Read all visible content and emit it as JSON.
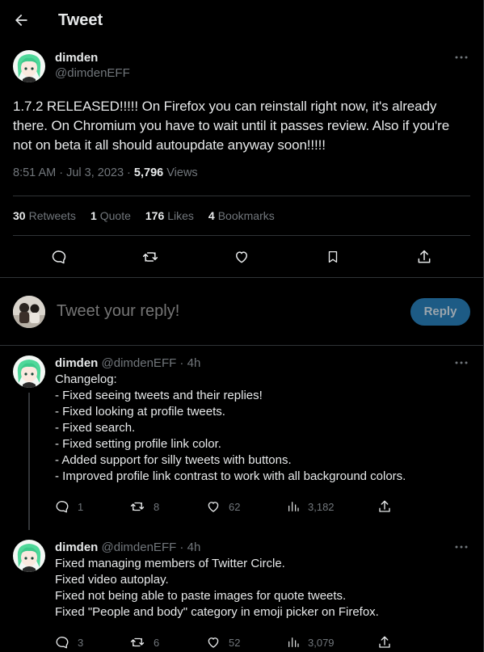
{
  "header": {
    "title": "Tweet"
  },
  "main_tweet": {
    "display_name": "dimden",
    "handle": "@dimdenEFF",
    "text": "1.7.2 RELEASED!!!!! On Firefox you can reinstall right now, it's already there. On Chromium you have to wait until it passes review. Also if you're not on beta it all should autoupdate anyway soon!!!!!",
    "timestamp": "8:51 AM · Jul 3, 2023 · ",
    "views_count": "5,796",
    "views_label": " Views",
    "stats": {
      "retweets_count": "30",
      "retweets_label": "Retweets",
      "quotes_count": "1",
      "quotes_label": "Quote",
      "likes_count": "176",
      "likes_label": "Likes",
      "bookmarks_count": "4",
      "bookmarks_label": "Bookmarks"
    }
  },
  "reply_box": {
    "placeholder": "Tweet your reply!",
    "button_label": "Reply"
  },
  "replies": [
    {
      "display_name": "dimden",
      "handle_time": " @dimdenEFF · 4h",
      "lines": [
        "Changelog:",
        "- Fixed seeing tweets and their replies!",
        "- Fixed looking at profile tweets.",
        "- Fixed search.",
        "- Fixed setting profile link color.",
        "- Added support for silly tweets with buttons.",
        "- Improved profile link contrast to work with all background colors."
      ],
      "replies": "1",
      "retweets": "8",
      "likes": "62",
      "views": "3,182"
    },
    {
      "display_name": "dimden",
      "handle_time": " @dimdenEFF · 4h",
      "lines": [
        "Fixed managing members of Twitter Circle.",
        "Fixed video autoplay.",
        "Fixed not being able to paste images for quote tweets.",
        "Fixed \"People and body\" category in emoji picker on Firefox."
      ],
      "replies": "3",
      "retweets": "6",
      "likes": "52",
      "views": "3,079"
    }
  ],
  "colors": {
    "background": "#000000",
    "text": "#e7e9ea",
    "secondary": "#71767b",
    "border": "#2f3336",
    "reply_button": "#1d5b85"
  }
}
